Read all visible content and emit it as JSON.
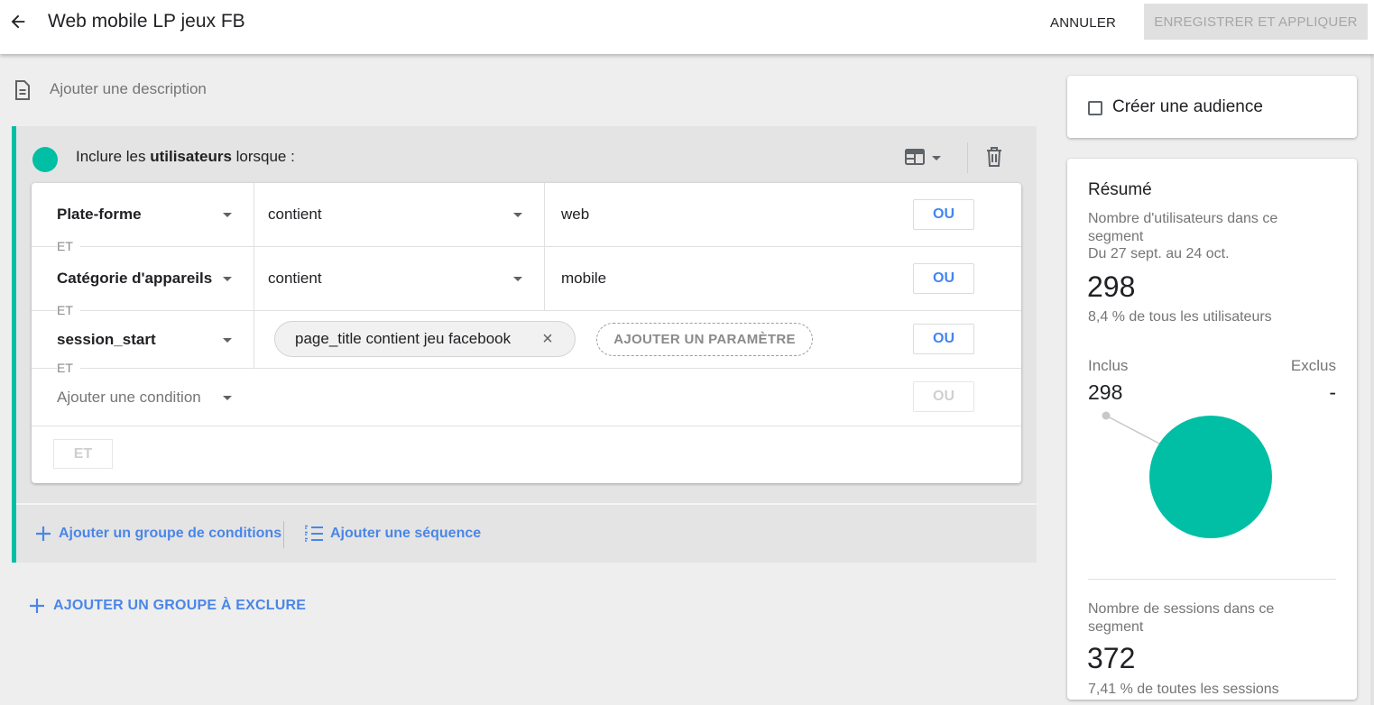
{
  "header": {
    "title": "Web mobile LP jeux FB",
    "cancel_label": "ANNULER",
    "save_label": "ENREGISTRER ET APPLIQUER"
  },
  "description": {
    "placeholder": "Ajouter une description"
  },
  "group": {
    "heading_prefix": "Inclure les ",
    "heading_bold": "utilisateurs",
    "heading_suffix": " lorsque :",
    "accent_color": "#00bfa5",
    "conditions": [
      {
        "dimension": "Plate-forme",
        "operator": "contient",
        "value": "web",
        "or_label": "OU"
      },
      {
        "dimension": "Catégorie d'appareils",
        "operator": "contient",
        "value": "mobile",
        "or_label": "OU"
      },
      {
        "dimension": "session_start",
        "chip": "page_title contient jeu facebook",
        "add_param": "AJOUTER UN PARAMÈTRE",
        "or_label": "OU"
      }
    ],
    "and_label": "ET",
    "add_condition_placeholder": "Ajouter une condition",
    "add_condition_or": "OU",
    "et_button": "ET",
    "add_condition_group": "Ajouter un groupe de conditions",
    "add_sequence": "Ajouter une séquence"
  },
  "add_exclude_group": "AJOUTER UN GROUPE À EXCLURE",
  "audience": {
    "label": "Créer une audience",
    "checked": false
  },
  "summary": {
    "title": "Résumé",
    "users_subtitle": "Nombre d'utilisateurs dans ce segment",
    "date_range": "Du 27 sept. au 24 oct.",
    "users_count": "298",
    "users_pct": "8,4 % de tous les utilisateurs",
    "included_label": "Inclus",
    "excluded_label": "Exclus",
    "included_value": "298",
    "excluded_value": "-",
    "pie_color": "#00bfa5",
    "sessions_subtitle": "Nombre de sessions dans ce segment",
    "sessions_count": "372",
    "sessions_pct": "7,41 % de toutes les sessions"
  },
  "link_color": "#4a86e8"
}
